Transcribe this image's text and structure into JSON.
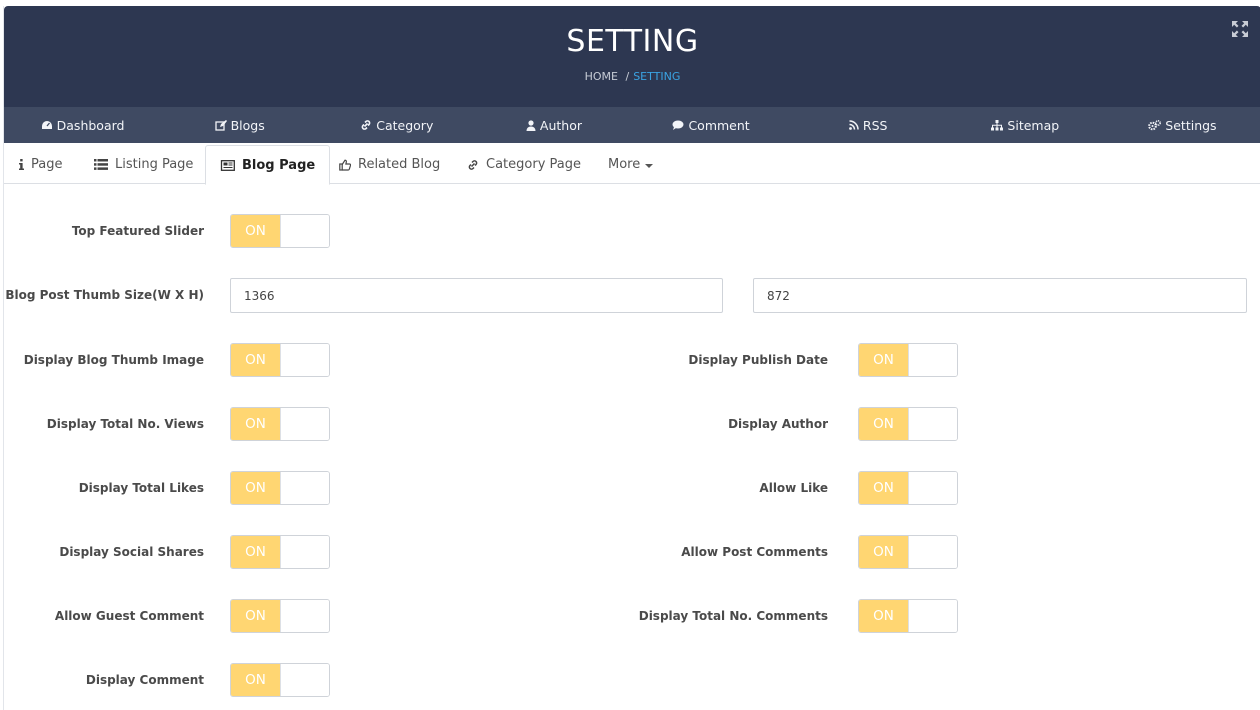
{
  "header": {
    "title": "SETTING",
    "breadcrumb": {
      "home": "HOME",
      "separator": "/",
      "current": "SETTING"
    }
  },
  "main_nav": [
    {
      "label": "Dashboard",
      "icon": "dashboard-icon"
    },
    {
      "label": "Blogs",
      "icon": "edit-icon"
    },
    {
      "label": "Category",
      "icon": "link-icon"
    },
    {
      "label": "Author",
      "icon": "user-icon"
    },
    {
      "label": "Comment",
      "icon": "comment-icon"
    },
    {
      "label": "RSS",
      "icon": "rss-icon"
    },
    {
      "label": "Sitemap",
      "icon": "sitemap-icon"
    },
    {
      "label": "Settings",
      "icon": "gears-icon"
    }
  ],
  "tabs": [
    {
      "label": "Page",
      "icon": "info-icon"
    },
    {
      "label": "Listing Page",
      "icon": "list-icon"
    },
    {
      "label": "Blog Page",
      "icon": "newspaper-icon",
      "active": true
    },
    {
      "label": "Related Blog",
      "icon": "thumbs-up-icon"
    },
    {
      "label": "Category Page",
      "icon": "link-icon"
    },
    {
      "label": "More",
      "icon": "caret-down-icon"
    }
  ],
  "form": {
    "top_featured_slider": {
      "label": "Top Featured Slider",
      "state": "ON"
    },
    "thumb_size": {
      "label": "Blog Post Thumb Size(W X H)",
      "width": "1366",
      "height": "872"
    },
    "left": [
      {
        "label": "Display Blog Thumb Image",
        "state": "ON"
      },
      {
        "label": "Display Total No. Views",
        "state": "ON"
      },
      {
        "label": "Display Total Likes",
        "state": "ON"
      },
      {
        "label": "Display Social Shares",
        "state": "ON"
      },
      {
        "label": "Allow Guest Comment",
        "state": "ON"
      },
      {
        "label": "Display Comment",
        "state": "ON"
      }
    ],
    "right": [
      {
        "label": "Display Publish Date",
        "state": "ON"
      },
      {
        "label": "Display Author",
        "state": "ON"
      },
      {
        "label": "Allow Like",
        "state": "ON"
      },
      {
        "label": "Allow Post Comments",
        "state": "ON"
      },
      {
        "label": "Display Total No. Comments",
        "state": "ON"
      }
    ]
  },
  "colors": {
    "header_bg": "#2d3751",
    "nav_bg": "#3f4a62",
    "toggle_on": "#ffd672",
    "breadcrumb_active": "#3aa3e3"
  }
}
